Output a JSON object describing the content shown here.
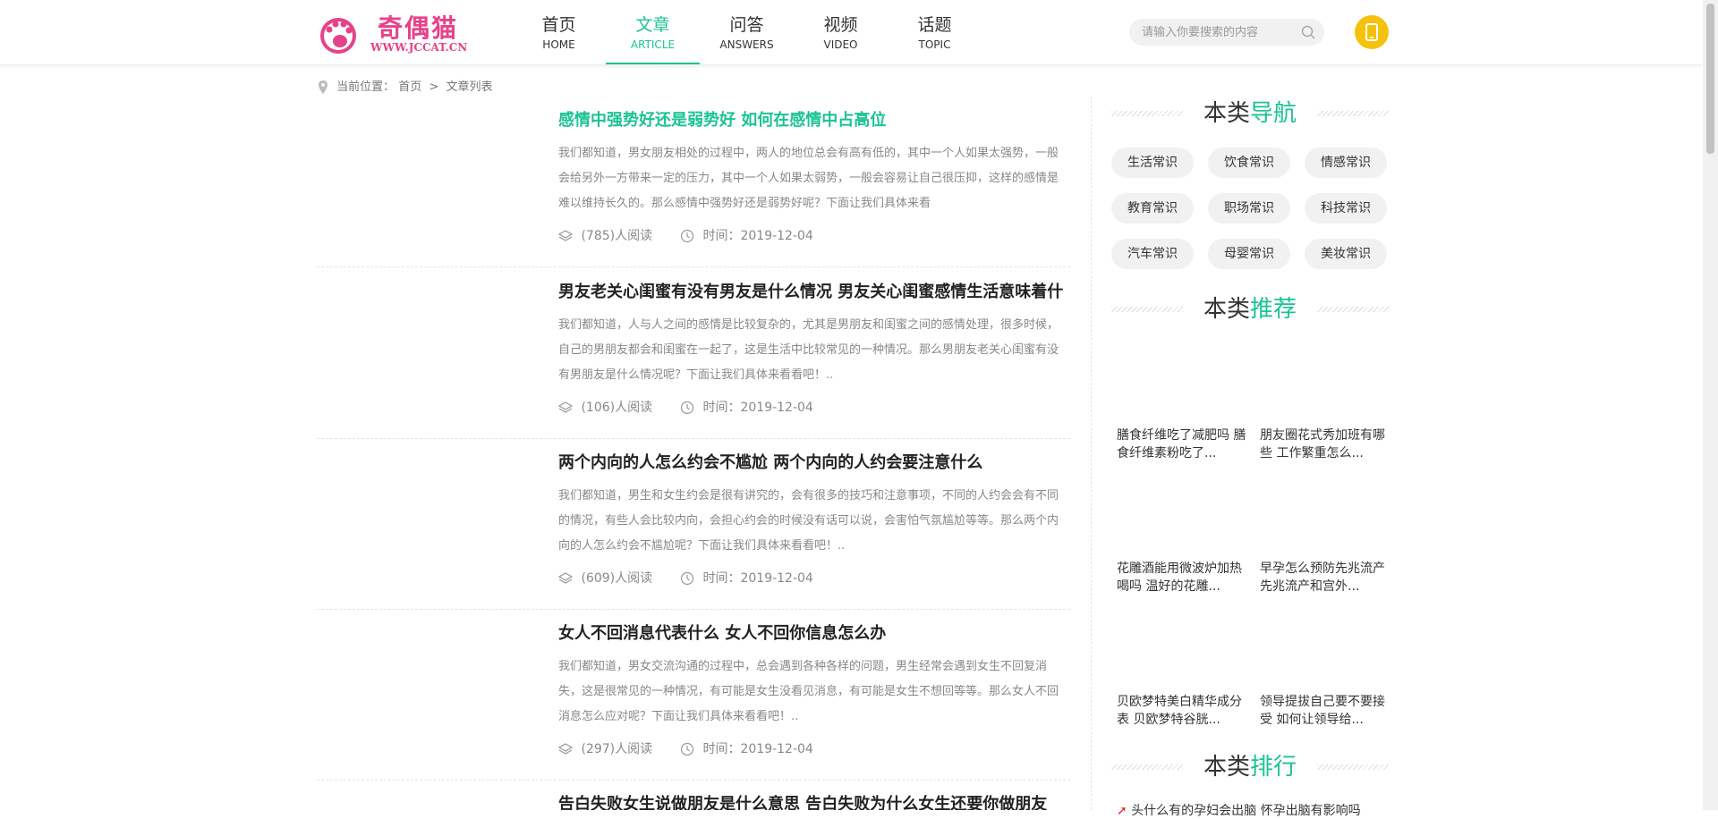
{
  "header": {
    "logo_text": "奇偶猫",
    "logo_url_text": "WWW.JCCAT.CN",
    "nav": [
      {
        "zh": "首页",
        "en": "HOME"
      },
      {
        "zh": "文章",
        "en": "ARTICLE"
      },
      {
        "zh": "问答",
        "en": "ANSWERS"
      },
      {
        "zh": "视频",
        "en": "VIDEO"
      },
      {
        "zh": "话题",
        "en": "TOPIC"
      }
    ],
    "search_placeholder": "请输入你要搜索的内容",
    "icons": {
      "search": "search-icon",
      "phone": "phone-icon"
    },
    "accent_color": "#1bc394",
    "phone_button_color": "#f5c20b"
  },
  "breadcrumb": {
    "label": "当前位置：",
    "home": "首页",
    "sep": ">",
    "current": "文章列表"
  },
  "articles": [
    {
      "title": "感情中强势好还是弱势好 如何在感情中占高位",
      "desc": "我们都知道，男女朋友相处的过程中，两人的地位总会有高有低的，其中一个人如果太强势，一般会给另外一方带来一定的压力，其中一个人如果太弱势，一般会容易让自己很压抑，这样的感情是难以维持长久的。那么感情中强势好还是弱势好呢？下面让我们具体来看",
      "reads": "(785)人阅读",
      "time": "时间：2019-12-04"
    },
    {
      "title": "男友老关心闺蜜有没有男友是什么情况 男友关心闺蜜感情生活意味着什",
      "desc": "我们都知道，人与人之间的感情是比较复杂的，尤其是男朋友和闺蜜之间的感情处理，很多时候，自己的男朋友都会和闺蜜在一起了，这是生活中比较常见的一种情况。那么男朋友老关心闺蜜有没有男朋友是什么情况呢？下面让我们具体来看看吧！..",
      "reads": "(106)人阅读",
      "time": "时间：2019-12-04"
    },
    {
      "title": "两个内向的人怎么约会不尴尬 两个内向的人约会要注意什么",
      "desc": "我们都知道，男生和女生约会是很有讲究的，会有很多的技巧和注意事项，不同的人约会会有不同的情况，有些人会比较内向，会担心约会的时候没有话可以说，会害怕气氛尴尬等等。那么两个内向的人怎么约会不尴尬呢？下面让我们具体来看看吧！..",
      "reads": "(609)人阅读",
      "time": "时间：2019-12-04"
    },
    {
      "title": "女人不回消息代表什么 女人不回你信息怎么办",
      "desc": "我们都知道，男女交流沟通的过程中，总会遇到各种各样的问题，男生经常会遇到女生不回复消失，这是很常见的一种情况，有可能是女生没看见消息，有可能是女生不想回等等。那么女人不回消息怎么应对呢？下面让我们具体来看看吧！..",
      "reads": "(297)人阅读",
      "time": "时间：2019-12-04"
    },
    {
      "title": "告白失败女生说做朋友是什么意思 告白失败为什么女生还要你做朋友",
      "desc": "",
      "reads": "",
      "time": ""
    }
  ],
  "sidebar": {
    "nav_title": {
      "a": "本类",
      "b": "导航"
    },
    "tags": [
      "生活常识",
      "饮食常识",
      "情感常识",
      "教育常识",
      "职场常识",
      "科技常识",
      "汽车常识",
      "母婴常识",
      "美妆常识"
    ],
    "rec_title": {
      "a": "本类",
      "b": "推荐"
    },
    "recommend": [
      "膳食纤维吃了减肥吗 膳食纤维素粉吃了...",
      "朋友圈花式秀加班有哪些 工作繁重怎么...",
      "花雕酒能用微波炉加热喝吗 温好的花雕...",
      "早孕怎么预防先兆流产 先兆流产和宫外...",
      "贝欧梦特美白精华成分表 贝欧梦特谷胱...",
      "领导提拔自己要不要接受 如何让领导给..."
    ],
    "rank_title": {
      "a": "本类",
      "b": "排行"
    },
    "rank_first": "头什么有的孕妇会出脑 怀孕出脑有影响吗"
  }
}
